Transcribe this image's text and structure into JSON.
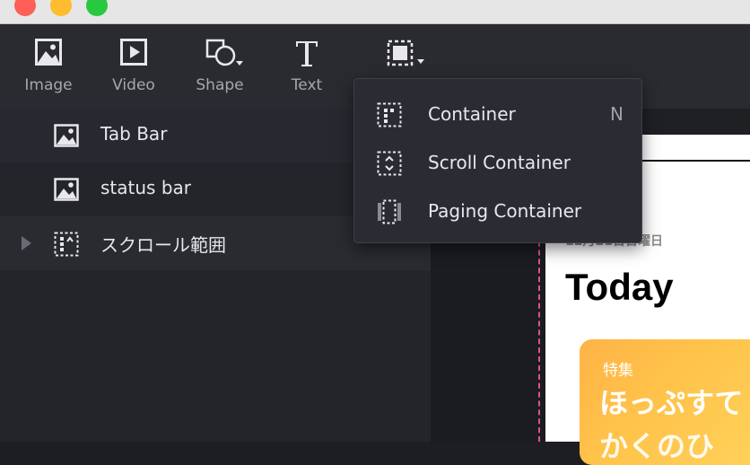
{
  "toolbar": {
    "items": [
      {
        "label": "Image",
        "icon": "image-icon"
      },
      {
        "label": "Video",
        "icon": "video-icon"
      },
      {
        "label": "Shape",
        "icon": "shape-icon"
      },
      {
        "label": "Text",
        "icon": "text-icon"
      },
      {
        "label": "",
        "icon": "container-icon"
      }
    ]
  },
  "layers": {
    "items": [
      {
        "label": "Tab Bar",
        "icon": "image-icon"
      },
      {
        "label": "status bar",
        "icon": "image-icon"
      },
      {
        "label": "スクロール範囲",
        "icon": "scroll-container-icon"
      }
    ]
  },
  "menu": {
    "items": [
      {
        "label": "Container",
        "shortcut": "N",
        "icon": "container-icon"
      },
      {
        "label": "Scroll Container",
        "shortcut": "",
        "icon": "scroll-container-icon"
      },
      {
        "label": "Paging Container",
        "shortcut": "",
        "icon": "paging-container-icon"
      }
    ]
  },
  "preview": {
    "date": "12月21日日曜日",
    "title": "Today",
    "card_tag": "特集",
    "card_title": "ほっぷすて",
    "card_title2": "かくのひ"
  },
  "colors": {
    "toolbar_bg": "#2a2b31",
    "menu_bg": "#2b2c33",
    "guide": "#e0508a",
    "card": "#ffc24a"
  }
}
